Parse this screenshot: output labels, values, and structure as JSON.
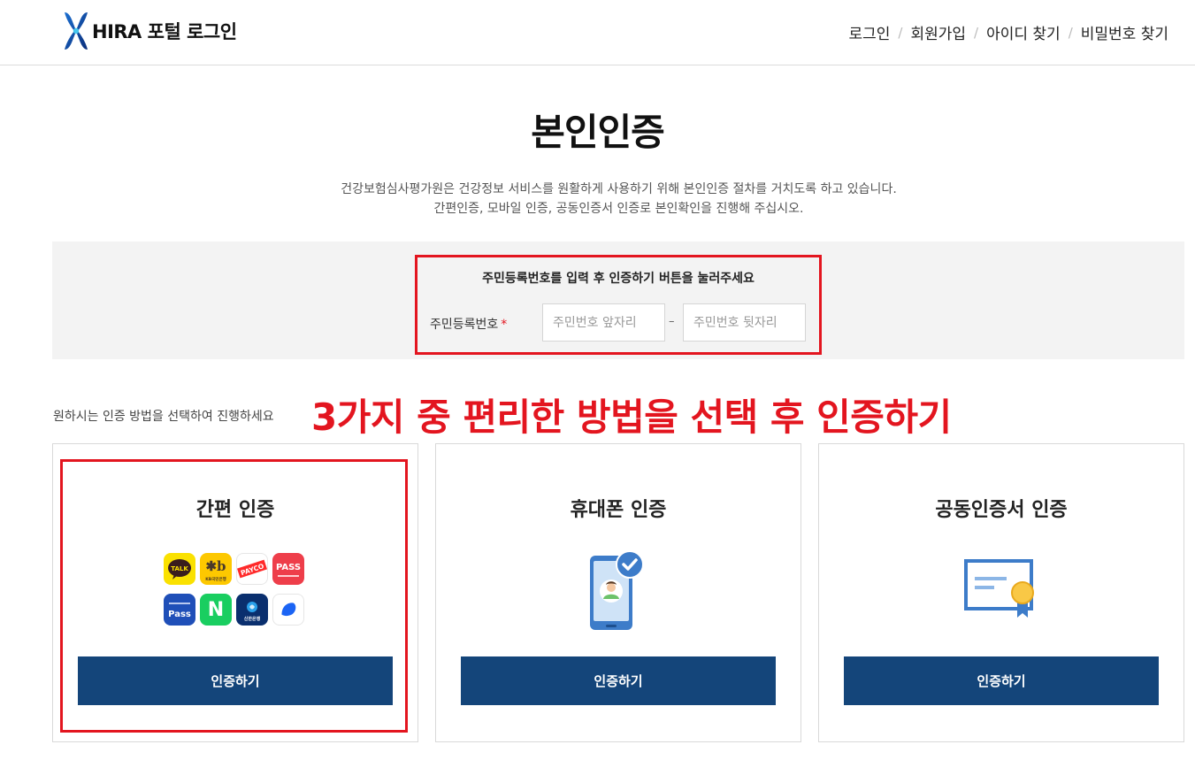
{
  "header": {
    "logo_text": "HIRA 포털 로그인",
    "nav": [
      "로그인",
      "회원가입",
      "아이디 찾기",
      "비밀번호 찾기"
    ]
  },
  "main": {
    "title": "본인인증",
    "desc_line1": "건강보험심사평가원은 건강정보 서비스를 원활하게 사용하기 위해 본인인증 절차를 거치도록 하고 있습니다.",
    "desc_line2": "간편인증, 모바일 인증, 공동인증서 인증로 본인확인을 진행해 주십시오."
  },
  "id_form": {
    "guide": "주민등록번호를 입력 후 인증하기 버튼을 눌러주세요",
    "label": "주민등록번호",
    "required_mark": "*",
    "front_placeholder": "주민번호 앞자리",
    "front_value": "",
    "back_placeholder": "주민번호 뒷자리",
    "back_value": "",
    "dash": "–"
  },
  "methods": {
    "guide": "원하시는 인증 방법을 선택하여 진행하세요",
    "annotation": "3가지 중 편리한 방법을 선택 후 인증하기",
    "cards": [
      {
        "title": "간편 인증",
        "button": "인증하기"
      },
      {
        "title": "휴대폰 인증",
        "button": "인증하기"
      },
      {
        "title": "공동인증서 인증",
        "button": "인증하기"
      }
    ],
    "apps": [
      {
        "name": "kakao-talk-icon",
        "label": "TALK"
      },
      {
        "name": "kb-bank-icon",
        "label": "KB국민은행"
      },
      {
        "name": "payco-icon",
        "label": "PAYCO"
      },
      {
        "name": "pass-icon",
        "label": "PASS"
      },
      {
        "name": "samsung-pass-icon",
        "label": "Pass"
      },
      {
        "name": "naver-icon",
        "label": "N"
      },
      {
        "name": "shinhan-bank-icon",
        "label": "신한은행"
      },
      {
        "name": "toss-icon",
        "label": ""
      }
    ]
  },
  "colors": {
    "primary_button": "#14457a",
    "highlight": "#e3151f",
    "panel_bg": "#f3f3f3"
  }
}
